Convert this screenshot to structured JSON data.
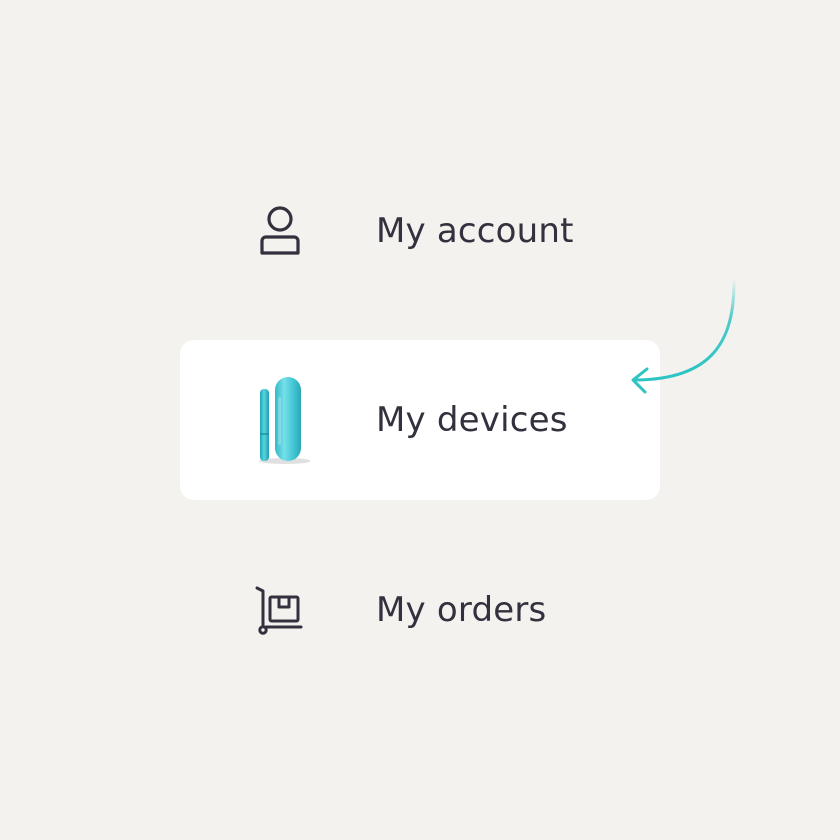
{
  "colors": {
    "background": "#f3f2ef",
    "card": "#ffffff",
    "text": "#34303d",
    "accent": "#2ec4c4"
  },
  "menu": {
    "items": [
      {
        "label": "My account",
        "icon": "person-icon",
        "active": false
      },
      {
        "label": "My devices",
        "icon": "device-image",
        "active": true
      },
      {
        "label": "My orders",
        "icon": "package-trolley-icon",
        "active": false
      }
    ]
  },
  "annotation": {
    "icon": "curved-arrow-icon",
    "points_to": "My devices"
  }
}
